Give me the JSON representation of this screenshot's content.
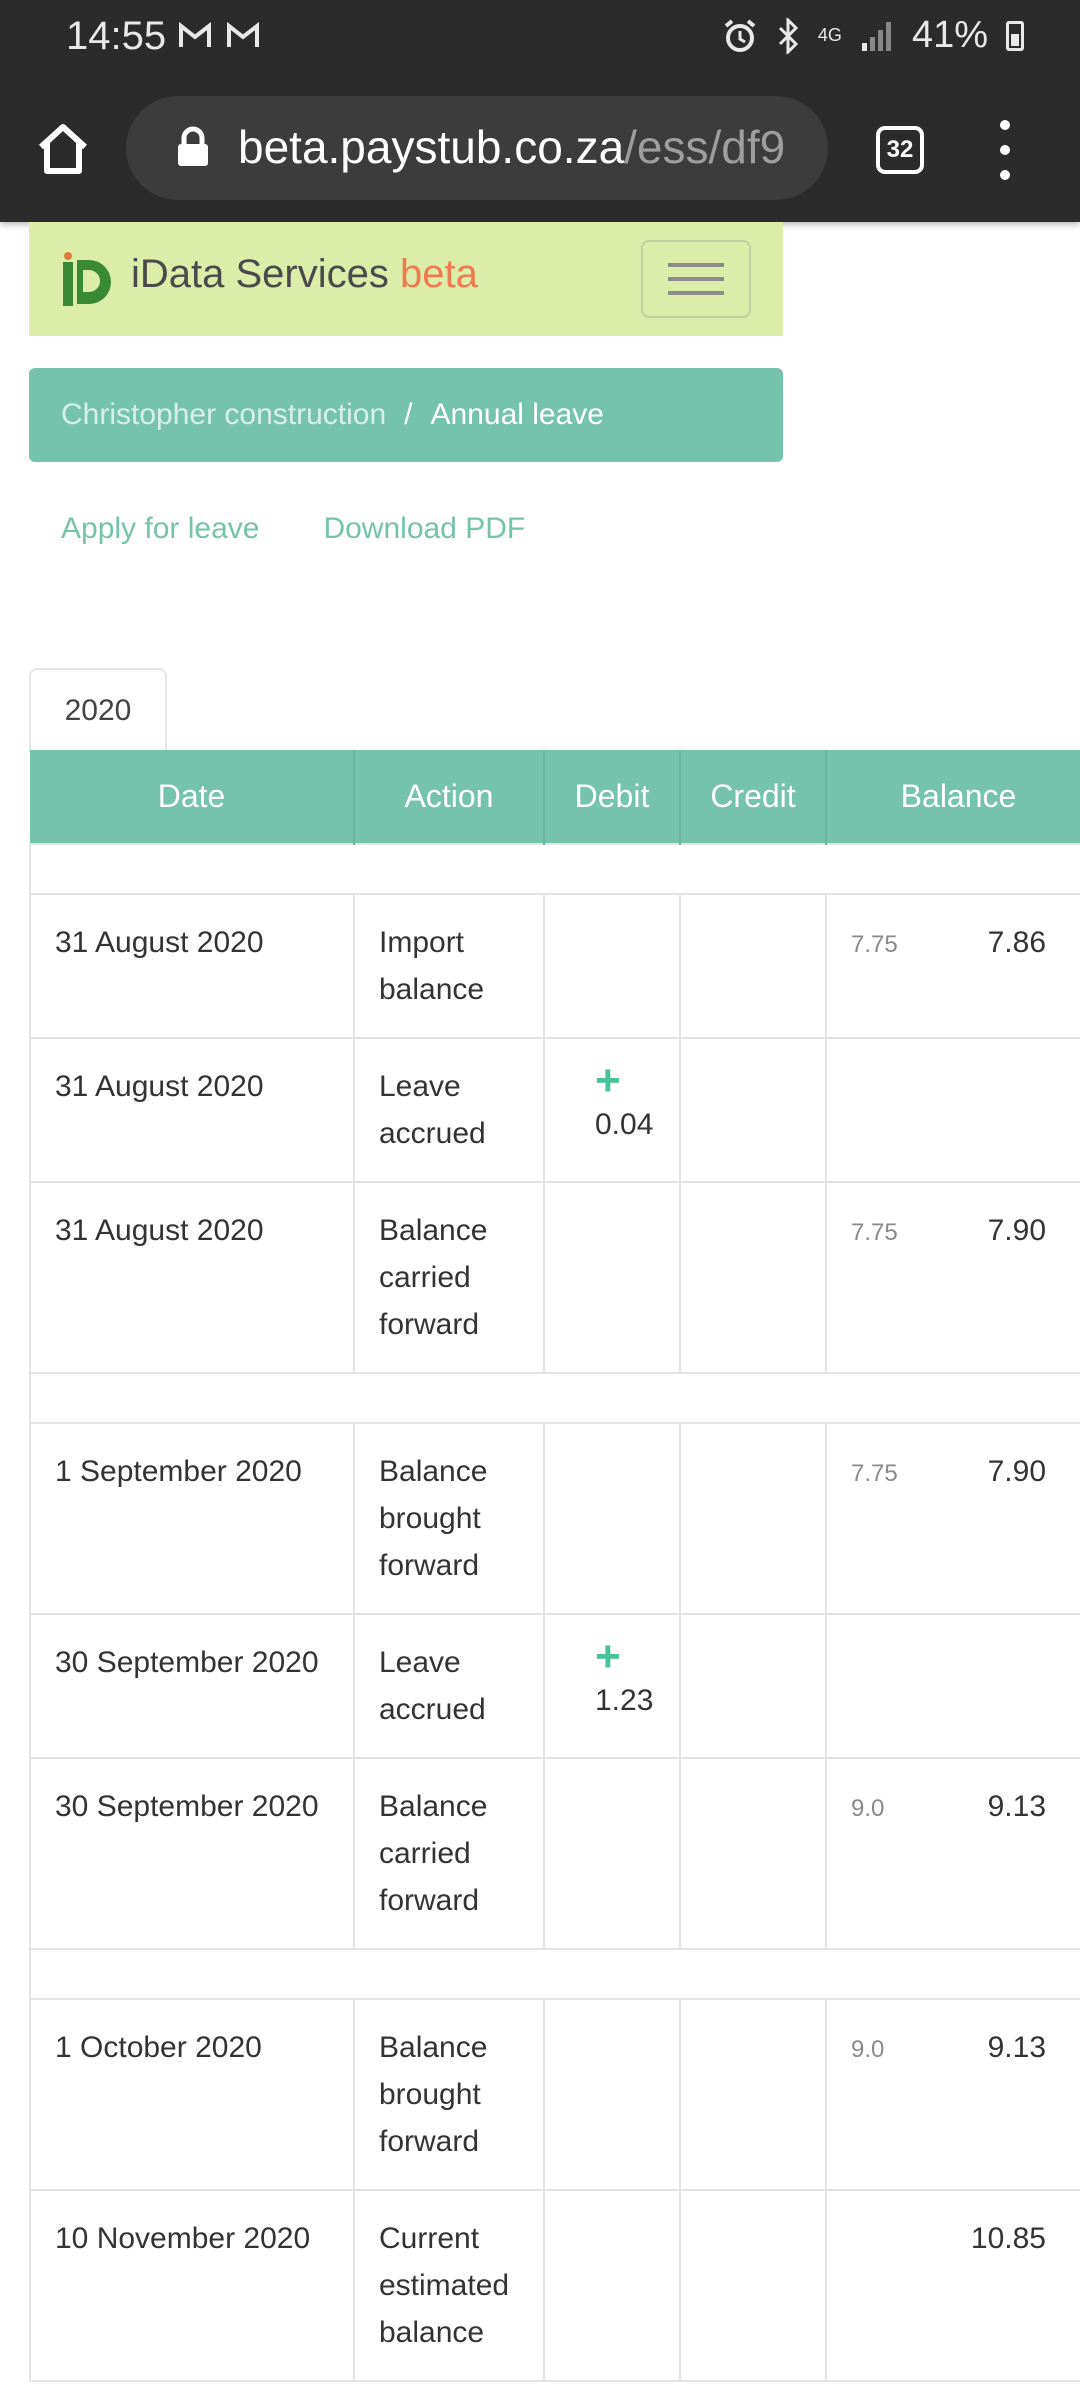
{
  "status_bar": {
    "time": "14:55",
    "battery": "41%",
    "network": "4G"
  },
  "browser": {
    "url_main": "beta.paystub.co.za",
    "url_path": "/ess/df9",
    "tab_count": "32"
  },
  "navbar": {
    "brand_name": "iData Services",
    "brand_suffix": "beta"
  },
  "breadcrumb": {
    "parent": "Christopher construction",
    "separator": "/",
    "current": "Annual leave"
  },
  "links": {
    "apply": "Apply for leave",
    "download": "Download PDF"
  },
  "tabs": {
    "year": "2020"
  },
  "table": {
    "headers": [
      "Date",
      "Action",
      "Debit",
      "Credit",
      "Balance"
    ],
    "rows": [
      {
        "date": "31 August 2020",
        "action": "Import balance",
        "debit": "",
        "credit": "",
        "prev": "7.75",
        "balance": "7.86"
      },
      {
        "date": "31 August 2020",
        "action": "Leave accrued",
        "debit": "0.04",
        "credit": "",
        "prev": "",
        "balance": ""
      },
      {
        "date": "31 August 2020",
        "action": "Balance carried forward",
        "debit": "",
        "credit": "",
        "prev": "7.75",
        "balance": "7.90"
      },
      {
        "date": "1 September 2020",
        "action": "Balance brought forward",
        "debit": "",
        "credit": "",
        "prev": "7.75",
        "balance": "7.90"
      },
      {
        "date": "30 September 2020",
        "action": "Leave accrued",
        "debit": "1.23",
        "credit": "",
        "prev": "",
        "balance": ""
      },
      {
        "date": "30 September 2020",
        "action": "Balance carried forward",
        "debit": "",
        "credit": "",
        "prev": "9.0",
        "balance": "9.13"
      },
      {
        "date": "1 October 2020",
        "action": "Balance brought forward",
        "debit": "",
        "credit": "",
        "prev": "9.0",
        "balance": "9.13"
      },
      {
        "date": "10 November 2020",
        "action": "Current estimated balance",
        "debit": "",
        "credit": "",
        "prev": "",
        "balance": "10.85"
      }
    ]
  },
  "colors": {
    "accent": "#76c3ab",
    "navbar_bg": "#dcedaa",
    "beta": "#f07a4f",
    "plus": "#47c397",
    "chrome": "#2b2b2b"
  }
}
